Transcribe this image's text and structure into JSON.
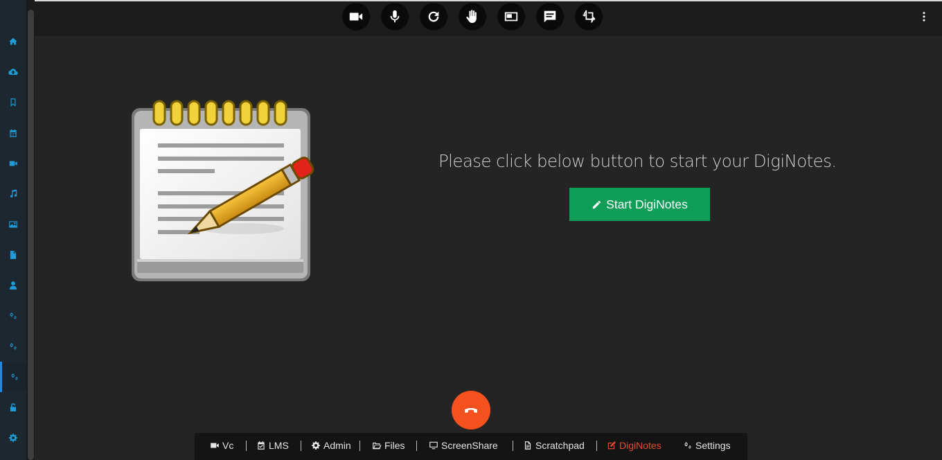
{
  "sidebar": {
    "items": [
      {
        "icon": "home-icon"
      },
      {
        "icon": "cloud-upload-icon"
      },
      {
        "icon": "bookmark-icon"
      },
      {
        "icon": "calendar-icon"
      },
      {
        "icon": "video-camera-icon"
      },
      {
        "icon": "music-icon"
      },
      {
        "icon": "image-icon"
      },
      {
        "icon": "file-icon"
      },
      {
        "icon": "user-icon"
      },
      {
        "icon": "cogs-icon"
      },
      {
        "icon": "cogs-icon"
      },
      {
        "icon": "cogs-icon",
        "active": true
      },
      {
        "icon": "unlock-icon"
      },
      {
        "icon": "gear-icon"
      }
    ]
  },
  "toolbar": {
    "buttons": [
      "video-camera-icon",
      "microphone-icon",
      "refresh-icon",
      "raise-hand-icon",
      "picture-in-picture-icon",
      "chat-icon",
      "crop-rotate-icon"
    ],
    "more": "more-vertical-icon"
  },
  "main": {
    "message": "Please click below button to start your DigiNotes.",
    "start_button_label": "Start DigiNotes",
    "start_button_icon": "pencil-icon"
  },
  "endcall": {
    "icon": "phone-hangup-icon",
    "color": "#f4511e"
  },
  "bottom_nav": {
    "vc": "Vc",
    "lms": "LMS",
    "admin": "Admin",
    "files": "Files",
    "screenshare": "ScreenShare",
    "scratchpad": "Scratchpad",
    "diginotes": "DigiNotes",
    "settings": "Settings",
    "active": "DigiNotes"
  },
  "colors": {
    "accent_sidebar": "#1f9bd7",
    "start_button": "#0f9d58",
    "active_tab": "#ea4a2f"
  }
}
